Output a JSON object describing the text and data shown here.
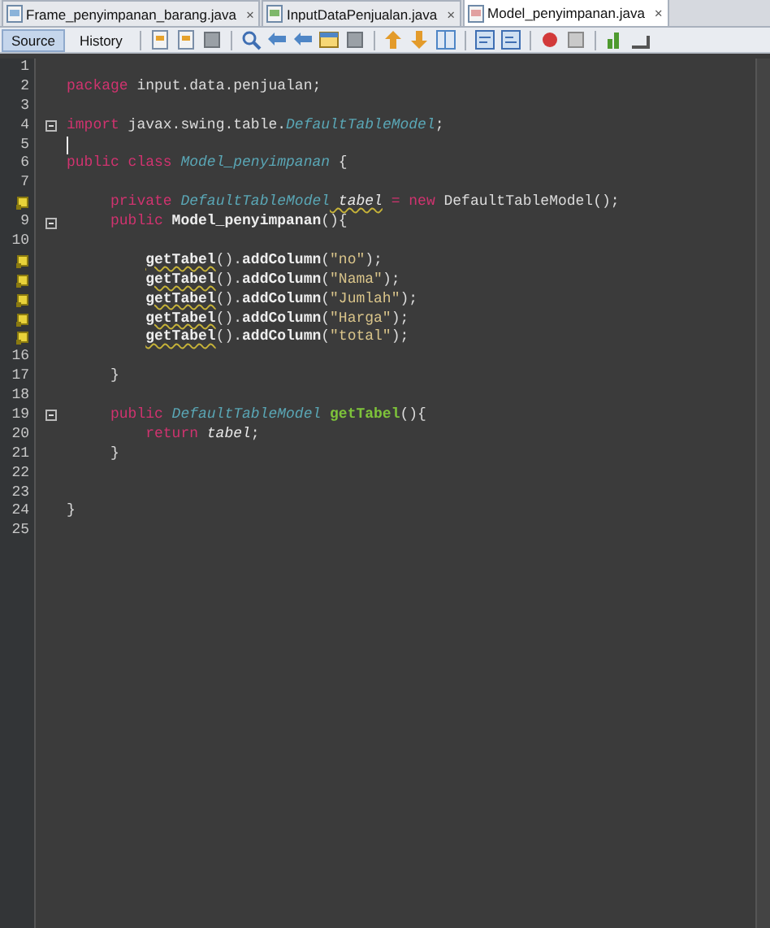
{
  "tabs": [
    {
      "label": "Frame_penyimpanan_barang.java",
      "selected": false,
      "close": "×"
    },
    {
      "label": "InputDataPenjualan.java",
      "selected": false,
      "close": "×"
    },
    {
      "label": "Model_penyimpanan.java",
      "selected": true,
      "close": "×"
    }
  ],
  "view_buttons": [
    {
      "label": "Source",
      "selected": true
    },
    {
      "label": "History",
      "selected": false
    }
  ],
  "toolbar": [
    {
      "kind": "file"
    },
    {
      "kind": "file"
    },
    {
      "kind": "square"
    },
    {
      "kind": "search"
    },
    {
      "kind": "left"
    },
    {
      "kind": "left"
    },
    {
      "kind": "window"
    },
    {
      "kind": "square"
    },
    {
      "kind": "up"
    },
    {
      "kind": "down"
    },
    {
      "kind": "split"
    },
    {
      "kind": "comment"
    },
    {
      "kind": "uncomment"
    },
    {
      "kind": "record"
    },
    {
      "kind": "stop"
    },
    {
      "kind": "chart"
    },
    {
      "kind": "graph"
    }
  ],
  "lines": [
    {
      "kind": "top",
      "number": "1"
    },
    {
      "kind": "top",
      "number": "2",
      "tokens": [
        {
          "kind": "keyword",
          "text": "package"
        },
        {
          "kind": "plain",
          "text": " input.data.penjualan;"
        }
      ]
    },
    {
      "kind": "top",
      "number": "3"
    },
    {
      "kind": "top",
      "number": "4",
      "fold": true,
      "tokens": [
        {
          "kind": "keyword",
          "text": "import"
        },
        {
          "kind": "plain",
          "text": " javax.swing.table."
        },
        {
          "kind": "type",
          "text": "DefaultTableModel"
        },
        {
          "kind": "plain",
          "text": ";"
        }
      ]
    },
    {
      "kind": "top",
      "number": "5",
      "caret": true
    },
    {
      "kind": "top",
      "number": "6",
      "tokens": [
        {
          "kind": "keyword",
          "text": "public class"
        },
        {
          "kind": "type",
          "text": " Model_penyimpanan"
        },
        {
          "kind": "plain",
          "text": " {"
        }
      ]
    },
    {
      "kind": "top",
      "number": "7"
    },
    {
      "kind": "member",
      "hint": true,
      "tokens": [
        {
          "kind": "keyword",
          "text": "private"
        },
        {
          "kind": "type",
          "text": " DefaultTableModel"
        },
        {
          "kind": "field",
          "text": " tabel"
        },
        {
          "kind": "keyword",
          "text": " ="
        },
        {
          "kind": "keyword",
          "text": " new"
        },
        {
          "kind": "plain",
          "text": " DefaultTableModel();"
        }
      ]
    },
    {
      "kind": "member",
      "number": "9",
      "fold": true,
      "tokens": [
        {
          "kind": "keyword",
          "text": "public"
        },
        {
          "kind": "method",
          "text": " Model_penyimpanan"
        },
        {
          "kind": "plain",
          "text": "(){"
        }
      ]
    },
    {
      "kind": "top",
      "number": "10"
    },
    {
      "kind": "body",
      "hint": true,
      "tokens": [
        {
          "kind": "call",
          "text": "getTabel"
        },
        {
          "kind": "plain",
          "text": "()."
        },
        {
          "kind": "method",
          "text": "addColumn"
        },
        {
          "kind": "plain",
          "text": "("
        },
        {
          "kind": "string",
          "text": "\"no\""
        },
        {
          "kind": "plain",
          "text": ");"
        }
      ]
    },
    {
      "kind": "body",
      "hint": true,
      "tokens": [
        {
          "kind": "call",
          "text": "getTabel"
        },
        {
          "kind": "plain",
          "text": "()."
        },
        {
          "kind": "method",
          "text": "addColumn"
        },
        {
          "kind": "plain",
          "text": "("
        },
        {
          "kind": "string",
          "text": "\"Nama\""
        },
        {
          "kind": "plain",
          "text": ");"
        }
      ]
    },
    {
      "kind": "body",
      "hint": true,
      "tokens": [
        {
          "kind": "call",
          "text": "getTabel"
        },
        {
          "kind": "plain",
          "text": "()."
        },
        {
          "kind": "method",
          "text": "addColumn"
        },
        {
          "kind": "plain",
          "text": "("
        },
        {
          "kind": "string",
          "text": "\"Jumlah\""
        },
        {
          "kind": "plain",
          "text": ");"
        }
      ]
    },
    {
      "kind": "body",
      "hint": true,
      "tokens": [
        {
          "kind": "call",
          "text": "getTabel"
        },
        {
          "kind": "plain",
          "text": "()."
        },
        {
          "kind": "method",
          "text": "addColumn"
        },
        {
          "kind": "plain",
          "text": "("
        },
        {
          "kind": "string",
          "text": "\"Harga\""
        },
        {
          "kind": "plain",
          "text": ");"
        }
      ]
    },
    {
      "kind": "body",
      "hint": true,
      "tokens": [
        {
          "kind": "call",
          "text": "getTabel"
        },
        {
          "kind": "plain",
          "text": "()."
        },
        {
          "kind": "method",
          "text": "addColumn"
        },
        {
          "kind": "plain",
          "text": "("
        },
        {
          "kind": "string",
          "text": "\"total\""
        },
        {
          "kind": "plain",
          "text": ");"
        }
      ]
    },
    {
      "kind": "top",
      "number": "16"
    },
    {
      "kind": "member",
      "number": "17",
      "tokens": [
        {
          "kind": "plain",
          "text": "}"
        }
      ]
    },
    {
      "kind": "top",
      "number": "18"
    },
    {
      "kind": "member",
      "number": "19",
      "fold": true,
      "tokens": [
        {
          "kind": "keyword",
          "text": "public"
        },
        {
          "kind": "type",
          "text": " DefaultTableModel"
        },
        {
          "kind": "decl",
          "text": " getTabel"
        },
        {
          "kind": "plain",
          "text": "(){"
        }
      ]
    },
    {
      "kind": "body",
      "number": "20",
      "tokens": [
        {
          "kind": "keyword",
          "text": "return"
        },
        {
          "kind": "local",
          "text": " tabel"
        },
        {
          "kind": "plain",
          "text": ";"
        }
      ]
    },
    {
      "kind": "member",
      "number": "21",
      "tokens": [
        {
          "kind": "plain",
          "text": "}"
        }
      ]
    },
    {
      "kind": "top",
      "number": "22"
    },
    {
      "kind": "top",
      "number": "23"
    },
    {
      "kind": "top",
      "number": "24",
      "tokens": [
        {
          "kind": "plain",
          "text": "}"
        }
      ]
    },
    {
      "kind": "top",
      "number": "25"
    }
  ]
}
